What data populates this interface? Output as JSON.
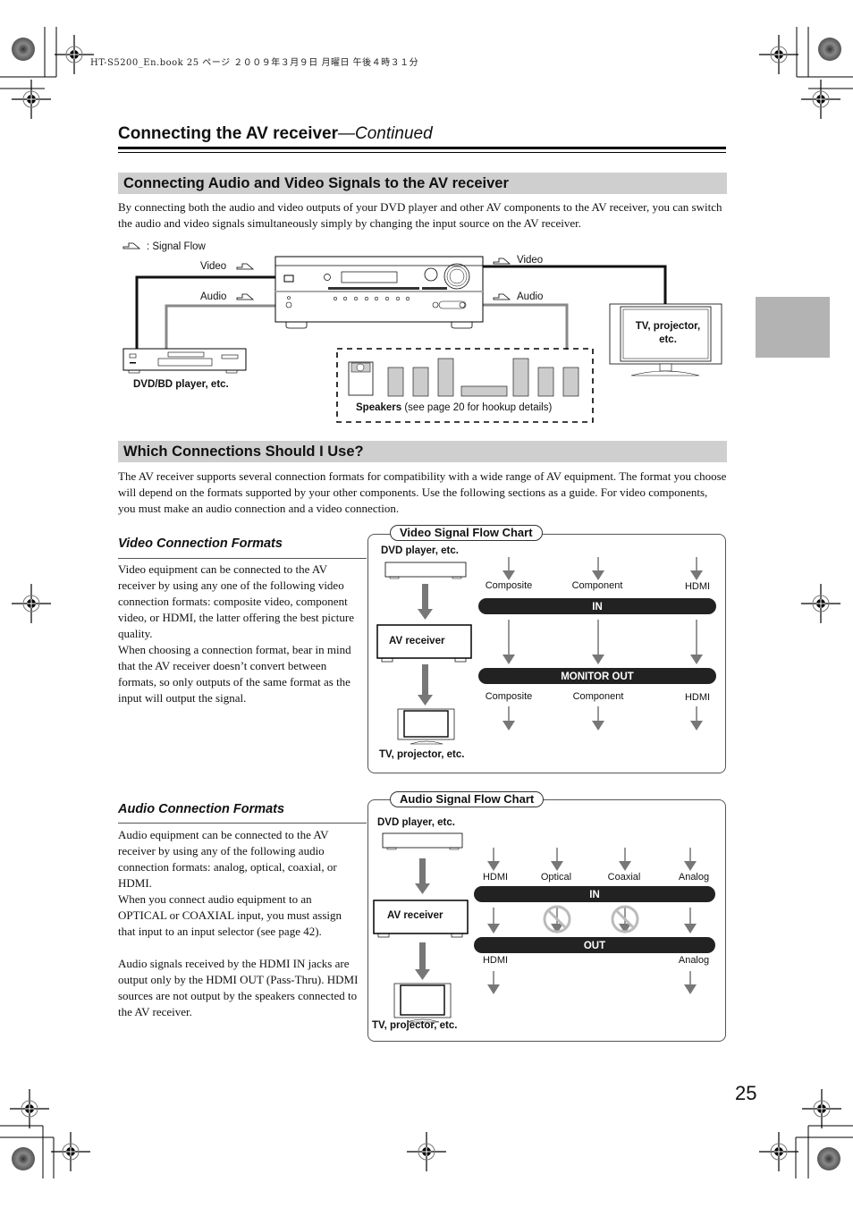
{
  "print_info": "HT-S5200_En.book  25 ページ  ２００９年３月９日  月曜日  午後４時３１分",
  "header": {
    "title": "Connecting the AV receiver",
    "title_suffix": "—Continued"
  },
  "section1": {
    "heading": "Connecting Audio and Video Signals to the AV receiver",
    "paragraph": "By connecting both the audio and video outputs of your DVD player and other AV components to the AV receiver, you can switch the audio and video signals simultaneously simply by changing the input source on the AV receiver.",
    "diagram": {
      "legend": ": Signal Flow",
      "video_in_label": "Video",
      "audio_in_label": "Audio",
      "video_out_label": "Video",
      "audio_out_label": "Audio",
      "source_label": "DVD/BD player, etc.",
      "display_label": "TV, projector, etc.",
      "speakers_label_bold": "Speakers",
      "speakers_label_rest": " (see page 20 for hookup details)"
    }
  },
  "section2": {
    "heading": "Which Connections Should I Use?",
    "paragraph": "The AV receiver supports several connection formats for compatibility with a wide range of AV equipment. The format you choose will depend on the formats supported by your other components. Use the following sections as a guide. For video components, you must make an audio connection and a video connection."
  },
  "video": {
    "heading": "Video Connection Formats",
    "para1": "Video equipment can be connected to the AV receiver by using any one of the following video connection formats: composite video, component video, or HDMI, the latter offering the best picture quality.",
    "para2": "When choosing a connection format, bear in mind that the AV receiver doesn’t convert between formats, so only outputs of the same format as the input will output the signal.",
    "chart": {
      "title": "Video Signal Flow Chart",
      "source": "DVD player, etc.",
      "receiver": "AV receiver",
      "display": "TV, projector, etc.",
      "in_bar": "IN",
      "out_bar": "MONITOR OUT",
      "inputs": [
        "Composite",
        "Component",
        "HDMI"
      ],
      "outputs": [
        "Composite",
        "Component",
        "HDMI"
      ]
    }
  },
  "audio": {
    "heading": "Audio Connection Formats",
    "para1": "Audio equipment can be connected to the AV receiver by using any of the following audio connection formats: analog, optical, coaxial, or HDMI.",
    "para2": "When you connect audio equipment to an OPTICAL or COAXIAL input, you must assign that input to an input selector (see page 42).",
    "para3": "Audio signals received by the HDMI IN jacks are output only by the HDMI OUT (Pass-Thru). HDMI sources are not output by the speakers connected to the AV receiver.",
    "chart": {
      "title": "Audio Signal Flow Chart",
      "source": "DVD player, etc.",
      "receiver": "AV receiver",
      "display": "TV, projector, etc.",
      "in_bar": "IN",
      "out_bar": "OUT",
      "inputs": [
        "HDMI",
        "Optical",
        "Coaxial",
        "Analog"
      ],
      "outputs": [
        "HDMI",
        "Analog"
      ],
      "blocked": [
        "Optical",
        "Coaxial"
      ]
    }
  },
  "page_number": "25"
}
